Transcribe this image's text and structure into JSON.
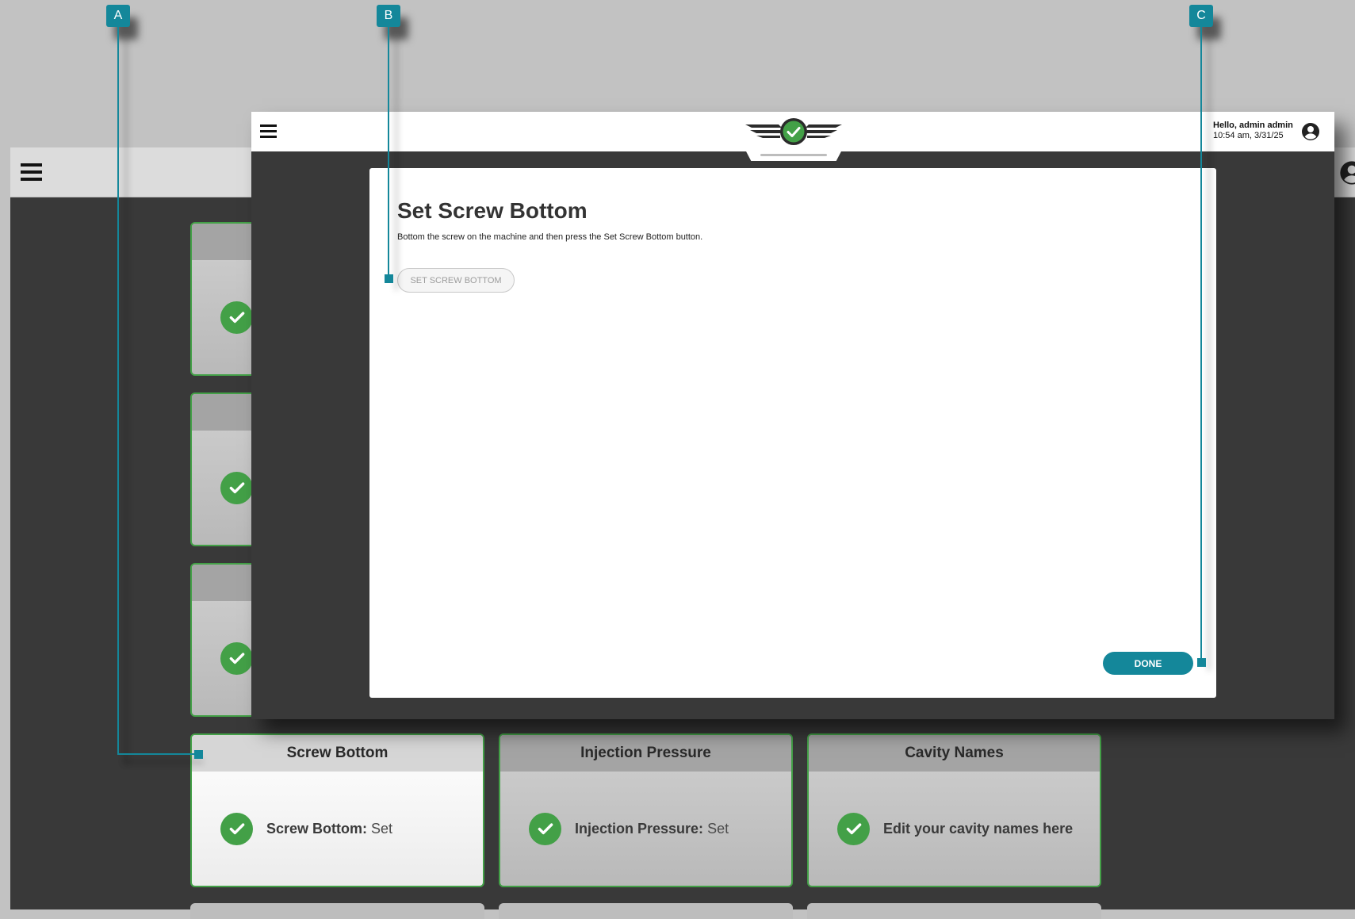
{
  "colors": {
    "accent": "#14879a",
    "success": "#43a047",
    "dark_background": "#393939",
    "page_background": "#c2c2c2"
  },
  "icons": {
    "menu": "hamburger-menu-icon",
    "user": "account-circle-icon",
    "status": "check-circle-icon",
    "logo": "winged-check-logo"
  },
  "background_screen": {
    "cards": [
      {
        "title": "Screw Bottom",
        "label": "Screw Bottom:",
        "value": "Set",
        "active": true
      },
      {
        "title": "Injection Pressure",
        "label": "Injection Pressure:",
        "value": "Set",
        "active": false
      },
      {
        "title": "Cavity Names",
        "label": "",
        "value": "Edit your cavity names here",
        "active": false
      }
    ]
  },
  "front_window": {
    "greeting": "Hello, admin admin",
    "timestamp": "10:54 am, 3/31/25"
  },
  "modal": {
    "title": "Set Screw Bottom",
    "description": "Bottom the screw on the machine and then press the Set Screw Bottom button.",
    "set_button_label": "SET SCREW BOTTOM",
    "done_label": "DONE"
  },
  "callouts": [
    "A",
    "B",
    "C"
  ]
}
